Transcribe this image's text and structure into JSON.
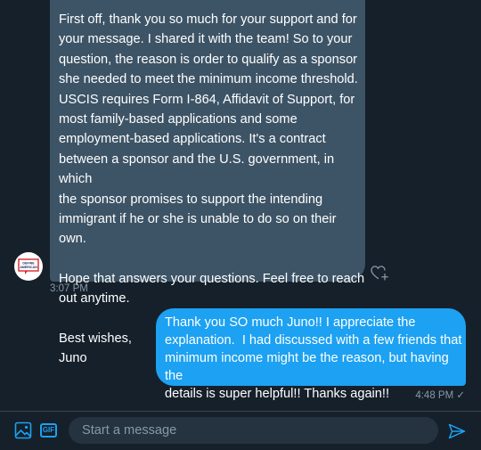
{
  "incoming_message": {
    "paragraphs": [
      "First off, thank you so much for your support and for\nyour message. I shared it with the team! So to your\nquestion, the reason is order to qualify as a sponsor\nshe needed to meet the minimum income threshold.\nUSCIS requires Form I-864, Affidavit of Support, for\nmost family-based applications and some\nemployment-based applications. It's a contract\nbetween a sponsor and the U.S. government, in which\nthe sponsor promises to support the intending\nimmigrant if he or she is unable to do so on their own.",
      "Hope that answers your questions. Feel free to reach\nout anytime.",
      "Best wishes,\nJuno"
    ],
    "timestamp": "3:07 PM",
    "avatar_text": "DEFINE\nAMERICAN"
  },
  "outgoing_message": {
    "text": "Thank you SO much Juno!! I appreciate the\nexplanation.  I had discussed with a few friends that\nminimum income might be the reason, but having the\ndetails is super helpful!! Thanks again!!",
    "timestamp": "4:48 PM ✓"
  },
  "composer": {
    "placeholder": "Start a message",
    "gif_label": "GIF",
    "media_icon": "image-icon",
    "send_icon": "send-icon"
  },
  "reaction": {
    "icon": "heart-add-icon"
  },
  "colors": {
    "background": "#15202b",
    "incoming_bubble": "#3d5466",
    "outgoing_bubble": "#1da1f2",
    "accent": "#1da1f2",
    "muted_text": "#8899a6",
    "input_background": "#253341"
  }
}
